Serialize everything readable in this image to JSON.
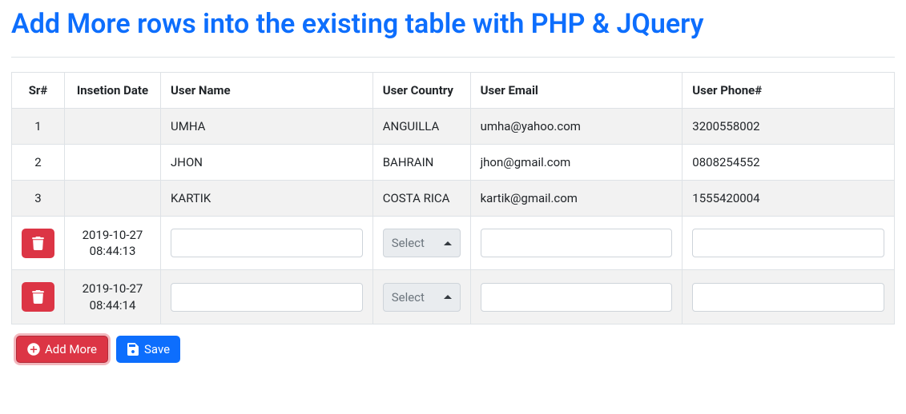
{
  "title": "Add More rows into the existing table with PHP & JQuery",
  "columns": {
    "sr": "Sr#",
    "date": "Insetion Date",
    "name": "User Name",
    "country": "User Country",
    "email": "User Email",
    "phone": "User Phone#"
  },
  "rows": [
    {
      "sr": "1",
      "date": "",
      "name": "UMHA",
      "country": "ANGUILLA",
      "email": "umha@yahoo.com",
      "phone": "3200558002"
    },
    {
      "sr": "2",
      "date": "",
      "name": "JHON",
      "country": "BAHRAIN",
      "email": "jhon@gmail.com",
      "phone": "0808254552"
    },
    {
      "sr": "3",
      "date": "",
      "name": "KARTIK",
      "country": "COSTA RICA",
      "email": "kartik@gmail.com",
      "phone": "1555420004"
    }
  ],
  "new_rows": [
    {
      "date_line1": "2019-10-27",
      "date_line2": "08:44:13",
      "name": "",
      "country_placeholder": "Select",
      "email": "",
      "phone": ""
    },
    {
      "date_line1": "2019-10-27",
      "date_line2": "08:44:14",
      "name": "",
      "country_placeholder": "Select",
      "email": "",
      "phone": ""
    }
  ],
  "buttons": {
    "add_more": "Add More",
    "save": "Save"
  }
}
